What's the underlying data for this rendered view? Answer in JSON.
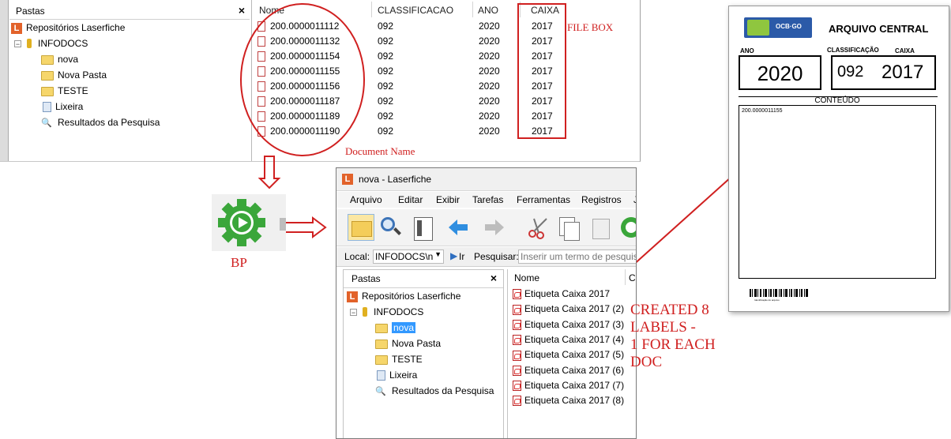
{
  "top_window": {
    "folders_panel": {
      "title": "Pastas",
      "close": "×",
      "items": [
        {
          "label": "Repositórios Laserfiche",
          "icon": "laserfiche-icon"
        },
        {
          "label": "INFODOCS",
          "icon": "repository-icon"
        },
        {
          "label": "nova",
          "icon": "folder-icon"
        },
        {
          "label": "Nova Pasta",
          "icon": "folder-icon"
        },
        {
          "label": "TESTE",
          "icon": "folder-icon"
        },
        {
          "label": "Lixeira",
          "icon": "recycle-bin-icon"
        },
        {
          "label": "Resultados da Pesquisa",
          "icon": "search-results-icon"
        }
      ]
    },
    "file_list": {
      "columns": [
        "Nome",
        "CLASSIFICACAO",
        "ANO",
        "CAIXA"
      ],
      "rows": [
        [
          "200.0000011112",
          "092",
          "2020",
          "2017"
        ],
        [
          "200.0000011132",
          "092",
          "2020",
          "2017"
        ],
        [
          "200.0000011154",
          "092",
          "2020",
          "2017"
        ],
        [
          "200.0000011155",
          "092",
          "2020",
          "2017"
        ],
        [
          "200.0000011156",
          "092",
          "2020",
          "2017"
        ],
        [
          "200.0000011187",
          "092",
          "2020",
          "2017"
        ],
        [
          "200.0000011189",
          "092",
          "2020",
          "2017"
        ],
        [
          "200.0000011190",
          "092",
          "2020",
          "2017"
        ]
      ]
    }
  },
  "annotations": {
    "file_box": "FILE BOX",
    "document_name": "Document Name",
    "bp": "BP",
    "created_labels": [
      "CREATED 8",
      "LABELS -",
      "1 FOR EACH",
      "DOC"
    ]
  },
  "bottom_window": {
    "title": "nova - Laserfiche",
    "menu": [
      "Arquivo",
      "Editar",
      "Exibir",
      "Tarefas",
      "Ferramentas",
      "Registros",
      "J"
    ],
    "address": {
      "local_label": "Local:",
      "local_value": "INFODOCS\\n",
      "go": "Ir",
      "search_label": "Pesquisar:",
      "search_placeholder": "Inserir um termo de pesquisa"
    },
    "folders_panel": {
      "title": "Pastas",
      "close": "×",
      "items": [
        {
          "label": "Repositórios Laserfiche"
        },
        {
          "label": "INFODOCS"
        },
        {
          "label": "nova"
        },
        {
          "label": "Nova Pasta"
        },
        {
          "label": "TESTE"
        },
        {
          "label": "Lixeira"
        },
        {
          "label": "Resultados da Pesquisa"
        }
      ]
    },
    "list_header": "Nome",
    "list_header_2": "C",
    "files": [
      "Etiqueta Caixa 2017",
      "Etiqueta Caixa 2017 (2)",
      "Etiqueta Caixa 2017 (3)",
      "Etiqueta Caixa 2017 (4)",
      "Etiqueta Caixa 2017 (5)",
      "Etiqueta Caixa 2017 (6)",
      "Etiqueta Caixa 2017 (7)",
      "Etiqueta Caixa 2017 (8)"
    ]
  },
  "label_card": {
    "logo_text": "OCB·GO",
    "title": "ARQUIVO CENTRAL",
    "ano_label": "ANO",
    "ano_value": "2020",
    "classificacao_label": "CLASSIFICAÇÃO",
    "classificacao_value": "092",
    "caixa_label": "CAIXA",
    "caixa_value": "2017",
    "conteudo_label": "CONTEÚDO",
    "conteudo_value": "200.0000011155",
    "barcode_caption": "Identificação do arquivo"
  },
  "colors": {
    "annotation_red": "#d02020",
    "laserfiche_orange": "#e2622a",
    "gear_green": "#3aa63a",
    "selection_blue": "#3399ff"
  }
}
